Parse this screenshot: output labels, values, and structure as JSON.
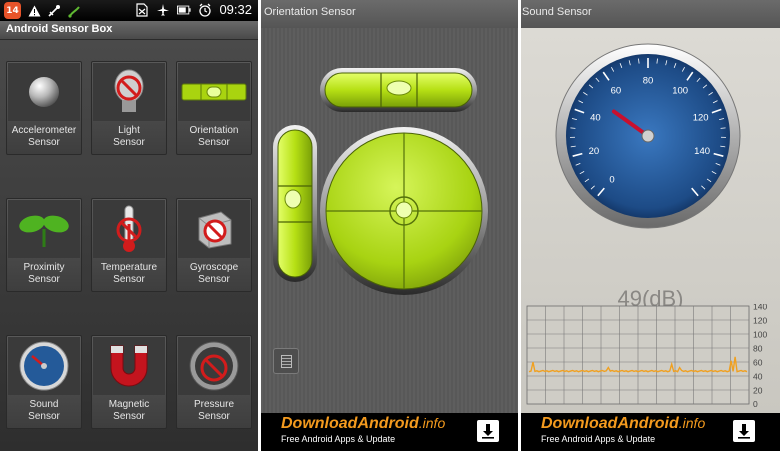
{
  "screen1": {
    "status_bar": {
      "badge": "14",
      "icons": [
        "notification-badge-icon",
        "warning-icon",
        "usb-debug-icon",
        "usb-icon",
        "no-sim-icon",
        "airplane-icon",
        "battery-icon",
        "alarm-icon"
      ],
      "time": "09:32"
    },
    "title": "Android Sensor Box",
    "tiles": [
      {
        "label": "Accelerometer Sensor",
        "icon": "accelerometer-ball-icon"
      },
      {
        "label": "Light Sensor",
        "icon": "light-bulb-disabled-icon"
      },
      {
        "label": "Orientation Sensor",
        "icon": "spirit-level-icon"
      },
      {
        "label": "Proximity Sensor",
        "icon": "sprout-icon"
      },
      {
        "label": "Temperature Sensor",
        "icon": "thermometer-disabled-icon"
      },
      {
        "label": "Gyroscope Sensor",
        "icon": "cube-disabled-icon"
      },
      {
        "label": "Sound Sensor",
        "icon": "speedometer-icon"
      },
      {
        "label": "Magnetic Sensor",
        "icon": "magnet-icon"
      },
      {
        "label": "Pressure Sensor",
        "icon": "gauge-disabled-icon"
      }
    ],
    "tile_rows": [
      [
        "Accelerometer",
        "Sensor"
      ],
      [
        "Light",
        "Sensor"
      ],
      [
        "Orientation",
        "Sensor"
      ],
      [
        "Proximity",
        "Sensor"
      ],
      [
        "Temperature",
        "Sensor"
      ],
      [
        "Gyroscope",
        "Sensor"
      ],
      [
        "Sound",
        "Sensor"
      ],
      [
        "Magnetic",
        "Sensor"
      ],
      [
        "Pressure",
        "Sensor"
      ]
    ]
  },
  "screen2": {
    "title": "Orientation Sensor",
    "menu_icon": "menu-list-icon"
  },
  "screen3": {
    "title": "Sound Sensor",
    "gauge": {
      "ticks": [
        "0",
        "20",
        "40",
        "60",
        "80",
        "100",
        "120",
        "140"
      ],
      "value_db": 49,
      "needle_color": "#c8102e",
      "dial_color": "#1f4e8a"
    },
    "reading": "49(dB)",
    "history": {
      "y_labels": [
        "140",
        "120",
        "100",
        "80",
        "60",
        "40",
        "20",
        "0"
      ],
      "line_color": "#f0a020",
      "baseline_db": 47
    }
  },
  "ad_banner": {
    "brand": "DownloadAndroid",
    "brand_suffix": ".info",
    "tagline": "Free Android Apps & Update",
    "download_icon": "download-arrow-icon",
    "brand_color": "#f39a1e"
  },
  "colors": {
    "level_green": "#b8e21a",
    "tile_bg": "#3a3a3a",
    "status_badge": "#e8542a"
  }
}
